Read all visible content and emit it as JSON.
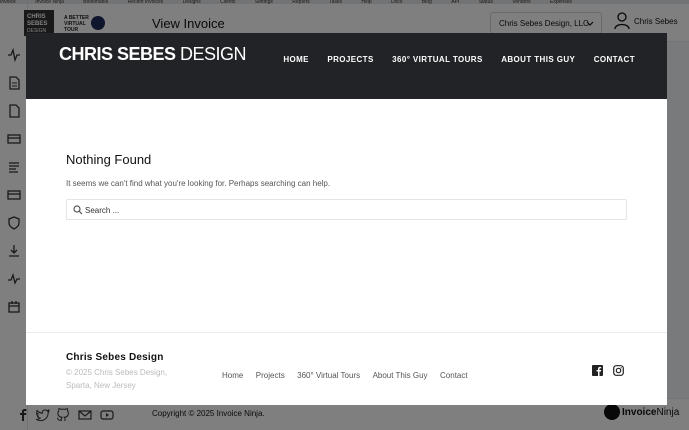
{
  "bookmarks": [
    "Invoice",
    "Invoice Ninja",
    "Bookmarks",
    "Recent Invoices",
    "Designs",
    "Clients",
    "Settings",
    "Reports",
    "Tasks",
    "Help",
    "Docs",
    "Blog",
    "API",
    "Status",
    "Vendors",
    "Expenses"
  ],
  "app": {
    "header_title": "View Invoice",
    "company_select": "Chris Sebes Design, LLC",
    "user_name": "Chris Sebes",
    "copyright": "Copyright © 2025 Invoice Ninja.",
    "brand": "Invoice Ninja",
    "brand_parts": {
      "first": "Invoice",
      "second": "Ninja"
    },
    "logo_text": [
      "CHRIS SEBES DESIGN",
      "A BETTER VIRTUAL TOUR"
    ]
  },
  "sidebar_icons": [
    "activity-icon",
    "invoice-icon",
    "file-icon",
    "credit-card-icon",
    "list-icon",
    "card-icon",
    "shield-icon",
    "download-icon",
    "chart-icon",
    "calendar-icon"
  ],
  "social_icons": [
    "facebook-icon",
    "twitter-icon",
    "github-icon",
    "mail-icon",
    "youtube-icon"
  ],
  "modal": {
    "site_logo": {
      "bold": "CHRIS SEBES",
      "thin": "DESIGN"
    },
    "nav": [
      "HOME",
      "PROJECTS",
      "360° VIRTUAL TOURS",
      "ABOUT THIS GUY",
      "CONTACT"
    ],
    "content": {
      "title": "Nothing Found",
      "message": "It seems we can't find what you're looking for. Perhaps searching can help.",
      "search_placeholder": "Search ..."
    },
    "footer": {
      "brand": "Chris Sebes Design",
      "copy_line1": "© 2025 Chris Sebes Design,",
      "copy_line2": "Sparta, New Jersey",
      "nav": [
        "Home",
        "Projects",
        "360° Virtual Tours",
        "About This Guy",
        "Contact"
      ],
      "social": [
        "facebook-icon",
        "instagram-icon"
      ]
    }
  },
  "colors": {
    "site_header_bg": "#222326",
    "overlay": "rgba(0,0,0,0.5)"
  }
}
